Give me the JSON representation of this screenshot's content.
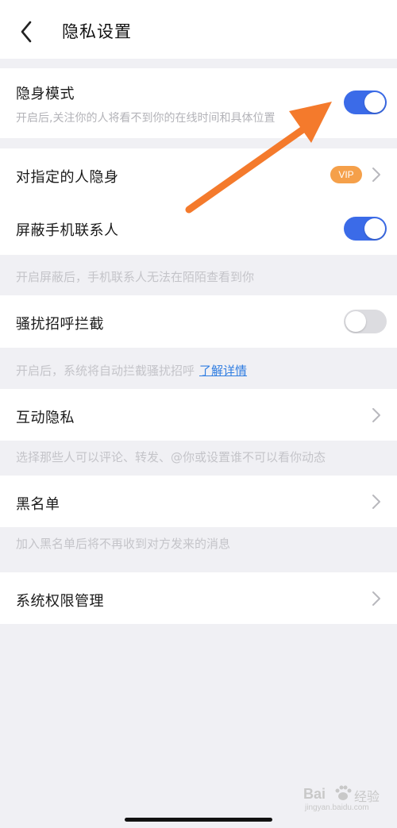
{
  "header": {
    "title": "隐私设置"
  },
  "settings": {
    "stealth": {
      "label": "隐身模式",
      "description": "开启后,关注你的人将看不到你的在线时间和具体位置",
      "enabled": true
    },
    "hide_from": {
      "label": "对指定的人隐身",
      "badge": "VIP"
    },
    "block_contacts": {
      "label": "屏蔽手机联系人",
      "enabled": true,
      "note": "开启屏蔽后，手机联系人无法在陌陌查看到你"
    },
    "harass_block": {
      "label": "骚扰招呼拦截",
      "enabled": false,
      "note": "开启后，系统将自动拦截骚扰招呼",
      "link": "了解详情"
    },
    "interaction": {
      "label": "互动隐私",
      "note": "选择那些人可以评论、转发、@你或设置谁不可以看你动态"
    },
    "blacklist": {
      "label": "黑名单",
      "note": "加入黑名单后将不再收到对方发来的消息"
    },
    "permissions": {
      "label": "系统权限管理"
    }
  },
  "watermark": {
    "brand": "Bai",
    "brand_cn": "经验",
    "url": "jingyan.baidu.com"
  },
  "colors": {
    "toggle_on": "#3b6be8",
    "toggle_off": "#dcdce0",
    "vip": "#f5a04a",
    "link": "#2f7de1",
    "arrow": "#f47a2c"
  }
}
